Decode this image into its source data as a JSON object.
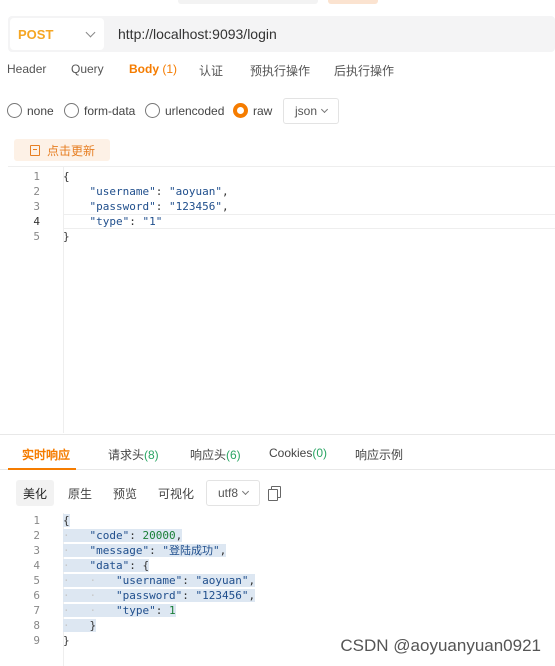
{
  "request": {
    "method": "POST",
    "url": "http://localhost:9093/login"
  },
  "request_tabs": [
    {
      "label": "Header",
      "count": ""
    },
    {
      "label": "Query",
      "count": ""
    },
    {
      "label": "Body",
      "count": "(1)"
    },
    {
      "label": "认证",
      "count": ""
    },
    {
      "label": "预执行操作",
      "count": ""
    },
    {
      "label": "后执行操作",
      "count": ""
    }
  ],
  "body_types": [
    "none",
    "form-data",
    "urlencoded",
    "raw"
  ],
  "body_types_selected": "raw",
  "body_format": "json",
  "refresh_label": "点击更新",
  "request_body_lines": [
    {
      "n": "1",
      "text": "{"
    },
    {
      "n": "2",
      "key": "\"username\"",
      "val": "\"aoyuan\"",
      "trail": ","
    },
    {
      "n": "3",
      "key": "\"password\"",
      "val": "\"123456\"",
      "trail": ","
    },
    {
      "n": "4",
      "key": "\"type\"",
      "val": "\"1\"",
      "trail": ""
    },
    {
      "n": "5",
      "text": "}"
    }
  ],
  "response_tabs": [
    {
      "label": "实时响应",
      "count": ""
    },
    {
      "label": "请求头",
      "count": "(8)"
    },
    {
      "label": "响应头",
      "count": "(6)"
    },
    {
      "label": "Cookies",
      "count": "(0)"
    },
    {
      "label": "响应示例",
      "count": ""
    }
  ],
  "response_views": [
    "美化",
    "原生",
    "预览",
    "可视化"
  ],
  "response_encoding": "utf8",
  "response_body_lines": [
    {
      "n": "1",
      "pre": "",
      "key": "",
      "val": "",
      "text": "{"
    },
    {
      "n": "2",
      "key": "\"code\"",
      "val": "20000",
      "trail": ","
    },
    {
      "n": "3",
      "key": "\"message\"",
      "val": "\"登陆成功\"",
      "trail": ","
    },
    {
      "n": "4",
      "key": "\"data\"",
      "val": "{",
      "trail": ""
    },
    {
      "n": "5",
      "key": "\"username\"",
      "val": "\"aoyuan\"",
      "trail": ","
    },
    {
      "n": "6",
      "key": "\"password\"",
      "val": "\"123456\"",
      "trail": ","
    },
    {
      "n": "7",
      "key": "\"type\"",
      "val": "1",
      "trail": ""
    },
    {
      "n": "8",
      "text": "}"
    },
    {
      "n": "9",
      "text": "}"
    }
  ],
  "watermark": "CSDN @aoyuanyuan0921",
  "colors": {
    "accent": "#f57c00",
    "method": "#f5a623",
    "count_green": "#2aa564"
  }
}
